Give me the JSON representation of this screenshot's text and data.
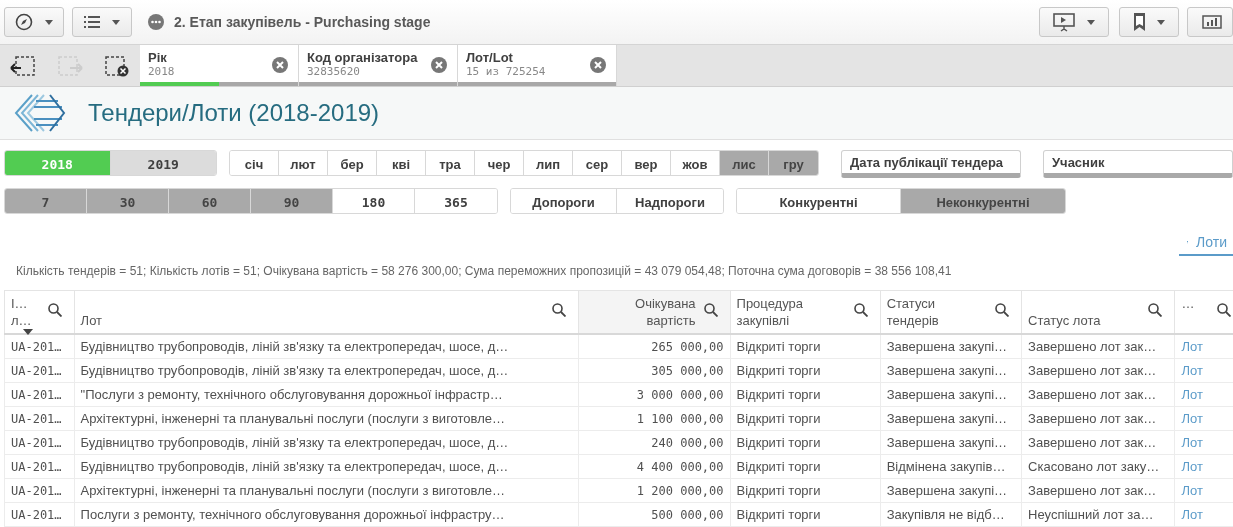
{
  "toolbar": {
    "title": "2. Етап закупівель - Purchasing stage"
  },
  "selections": [
    {
      "field": "Рік",
      "value": "2018",
      "level": 0.5
    },
    {
      "field": "Код організатора",
      "value": "32835620"
    },
    {
      "field": "Лот/Lot",
      "value": "15 из 725254"
    }
  ],
  "sheet": {
    "title": "Тендери/Лоти (2018-2019)"
  },
  "years": [
    {
      "label": "2018",
      "selected": true,
      "alternative": false
    },
    {
      "label": "2019",
      "selected": false,
      "alternative": true
    }
  ],
  "months": [
    {
      "label": "січ",
      "excluded": false
    },
    {
      "label": "лют",
      "excluded": false
    },
    {
      "label": "бер",
      "excluded": false
    },
    {
      "label": "кві",
      "excluded": false
    },
    {
      "label": "тра",
      "excluded": false
    },
    {
      "label": "чер",
      "excluded": false
    },
    {
      "label": "лип",
      "excluded": false
    },
    {
      "label": "сер",
      "excluded": false
    },
    {
      "label": "вер",
      "excluded": false
    },
    {
      "label": "жов",
      "excluded": false
    },
    {
      "label": "лис",
      "excluded": true
    },
    {
      "label": "гру",
      "excluded": true
    }
  ],
  "filters": [
    {
      "label": "Дата публікації тендера"
    },
    {
      "label": "Учасник"
    }
  ],
  "days": [
    {
      "label": "7",
      "excluded": true
    },
    {
      "label": "30",
      "excluded": true
    },
    {
      "label": "60",
      "excluded": true
    },
    {
      "label": "90",
      "excluded": true
    },
    {
      "label": "180",
      "excluded": false
    },
    {
      "label": "365",
      "excluded": false
    }
  ],
  "thresholds": [
    {
      "label": "Допороги",
      "excluded": false
    },
    {
      "label": "Надпороги",
      "excluded": false
    }
  ],
  "competition": [
    {
      "label": "Конкурентні",
      "excluded": false
    },
    {
      "label": "Неконкурентні",
      "excluded": true
    }
  ],
  "table_tab": {
    "label": "Лоти"
  },
  "summary": "Кількість тендерів = 51; Кількість лотів = 51; Очікувана вартість = 58 276 300,00; Сума переможних пропозицій = 43 079 054,48; Поточна сума договорів = 38 556 108,41",
  "table": {
    "columns": [
      {
        "label": "I…\nл…",
        "right_aligned": false,
        "sorted": true
      },
      {
        "label": "Лот",
        "right_aligned": false
      },
      {
        "label": "Очікувана\nвартість",
        "right_aligned": true
      },
      {
        "label": "Процедура\nзакупівлі",
        "right_aligned": false
      },
      {
        "label": "Статуси\nтендерів",
        "right_aligned": false
      },
      {
        "label": "Статус лота",
        "right_aligned": false
      },
      {
        "label": "…",
        "right_aligned": false
      }
    ],
    "rows": [
      [
        "UA-201…",
        "Будівництво трубопроводів, ліній зв'язку та електропередач, шосе, д…",
        "265 000,00",
        "Відкриті торги",
        "Завершена закупі…",
        "Завершено лот зак…",
        "Лот"
      ],
      [
        "UA-201…",
        "Будівництво трубопроводів, ліній зв'язку та електропередач, шосе, д…",
        "305 000,00",
        "Відкриті торги",
        "Завершена закупі…",
        "Завершено лот зак…",
        "Лот"
      ],
      [
        "UA-201…",
        "\"Послуги з ремонту, технічного обслуговування дорожньої інфрастр…",
        "3 000 000,00",
        "Відкриті торги",
        "Завершена закупі…",
        "Завершено лот зак…",
        "Лот"
      ],
      [
        "UA-201…",
        "Архітектурні, інженерні та планувальні послуги (послуги з виготовле…",
        "1 100 000,00",
        "Відкриті торги",
        "Завершена закупі…",
        "Завершено лот зак…",
        "Лот"
      ],
      [
        "UA-201…",
        "Будівництво трубопроводів, ліній зв'язку та електропередач, шосе, д…",
        "240 000,00",
        "Відкриті торги",
        "Завершена закупі…",
        "Завершено лот зак…",
        "Лот"
      ],
      [
        "UA-201…",
        "Будівництво трубопроводів, ліній зв'язку та електропередач, шосе, д…",
        "4 400 000,00",
        "Відкриті торги",
        "Відмінена закупів…",
        "Скасовано лот заку…",
        "Лот"
      ],
      [
        "UA-201…",
        "Архітектурні, інженерні та планувальні послуги (послуги з виготовле…",
        "1 200 000,00",
        "Відкриті торги",
        "Завершена закупі…",
        "Завершено лот зак…",
        "Лот"
      ],
      [
        "UA-201…",
        "Послуги з ремонту, технічного обслуговування дорожньої інфрастру…",
        "500 000,00",
        "Відкриті торги",
        "Закупівля не відб…",
        "Неуспішний лот за…",
        "Лот"
      ]
    ]
  }
}
